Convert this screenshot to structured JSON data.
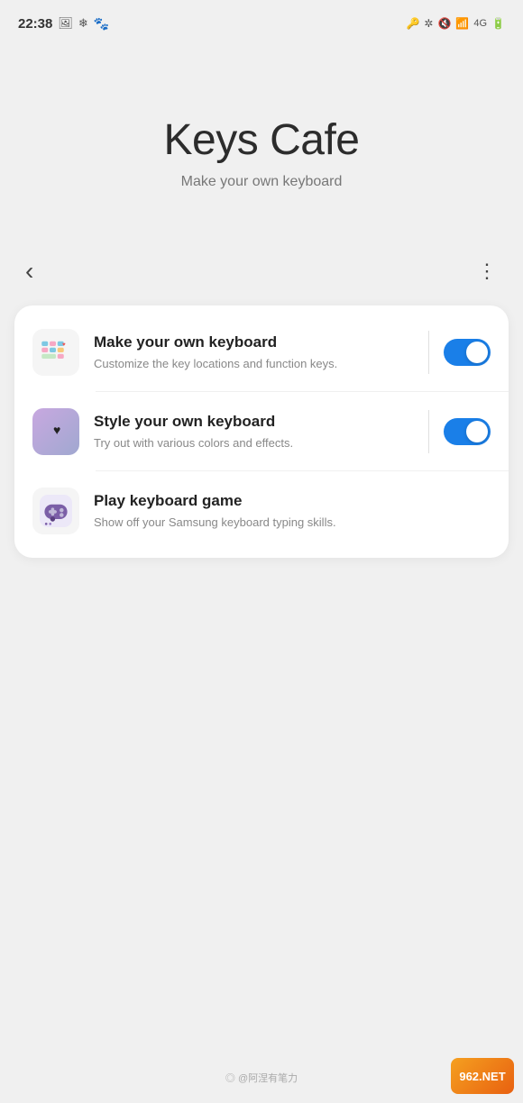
{
  "statusBar": {
    "time": "22:38",
    "leftIcons": [
      "image-icon",
      "snowflake-icon",
      "wechat-icon"
    ],
    "rightIcons": [
      "key-icon",
      "bluetooth-icon",
      "mute-icon",
      "wifi-icon",
      "4g-icon",
      "battery-icon"
    ]
  },
  "hero": {
    "title": "Keys Cafe",
    "subtitle": "Make your own keyboard"
  },
  "nav": {
    "back_label": "‹",
    "more_label": "⋮"
  },
  "card": {
    "items": [
      {
        "id": "make-keyboard",
        "title": "Make your own keyboard",
        "description": "Customize the key locations and function keys.",
        "hasToggle": true,
        "toggleOn": true,
        "hasDivider": true
      },
      {
        "id": "style-keyboard",
        "title": "Style your own keyboard",
        "description": "Try out with various colors and effects.",
        "hasToggle": true,
        "toggleOn": true,
        "hasDivider": true
      },
      {
        "id": "play-game",
        "title": "Play keyboard game",
        "description": "Show off your Samsung keyboard typing skills.",
        "hasToggle": false,
        "toggleOn": false,
        "hasDivider": false
      }
    ]
  },
  "watermark": {
    "text": "◎ @阿涅有笔力"
  },
  "badge": {
    "text": "962.NET"
  }
}
